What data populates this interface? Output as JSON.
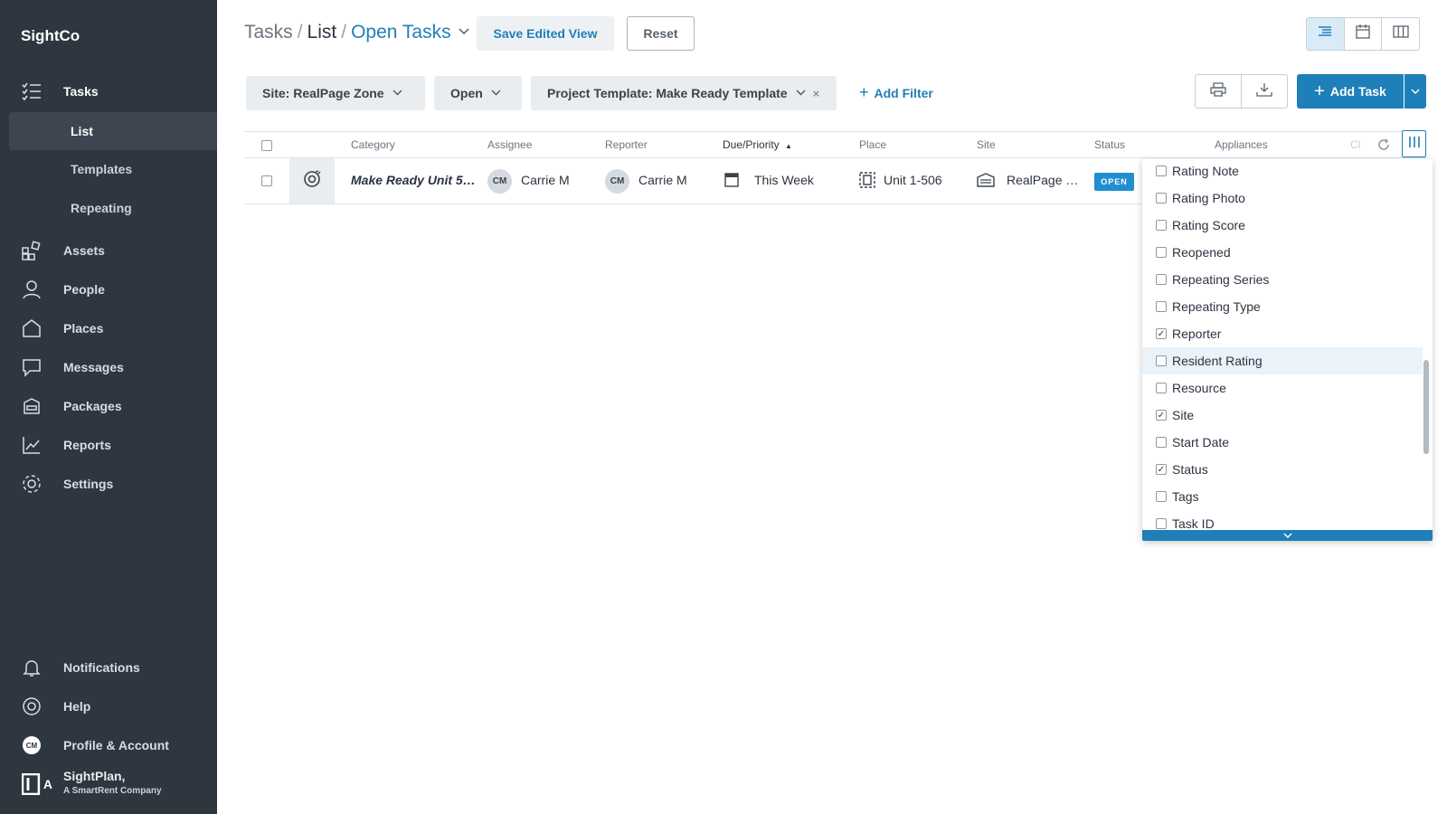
{
  "app": {
    "brand": "SightCo"
  },
  "sidebar": {
    "items": [
      {
        "label": "Tasks",
        "icon": "tasks-icon"
      },
      {
        "label": "Assets",
        "icon": "assets-icon"
      },
      {
        "label": "People",
        "icon": "person-icon"
      },
      {
        "label": "Places",
        "icon": "home-icon"
      },
      {
        "label": "Messages",
        "icon": "chat-icon"
      },
      {
        "label": "Packages",
        "icon": "package-icon"
      },
      {
        "label": "Reports",
        "icon": "chart-icon"
      },
      {
        "label": "Settings",
        "icon": "gear-icon"
      }
    ],
    "subitems": [
      {
        "label": "List",
        "active": true
      },
      {
        "label": "Templates"
      },
      {
        "label": "Repeating"
      }
    ],
    "bottom": {
      "notifications": "Notifications",
      "help": "Help",
      "profile": "Profile & Account",
      "profile_initials": "CM",
      "logo_line1": "SightPlan,",
      "logo_line2": "A SmartRent Company",
      "logo_letter": "A"
    }
  },
  "header": {
    "breadcrumb": {
      "root": "Tasks",
      "sep": "/",
      "current": "List",
      "view": "Open Tasks"
    },
    "save_view": "Save Edited View",
    "reset": "Reset"
  },
  "filters": {
    "site": "Site: RealPage Zone",
    "status": "Open",
    "template": "Project Template: Make Ready Template",
    "remove": "×",
    "add_filter": "Add Filter"
  },
  "actions": {
    "add_task": "Add Task"
  },
  "table": {
    "columns": [
      "Category",
      "Assignee",
      "Reporter",
      "Due/Priority",
      "Place",
      "Site",
      "Status",
      "Appliances",
      "Cl"
    ],
    "sort_indicator": "▲",
    "rows": [
      {
        "title": "Make Ready Unit 5…",
        "assignee_initials": "CM",
        "assignee": "Carrie M",
        "reporter_initials": "CM",
        "reporter": "Carrie M",
        "due": "This Week",
        "place": "Unit 1-506",
        "site": "RealPage …",
        "status": "OPEN"
      }
    ]
  },
  "column_picker": {
    "items": [
      {
        "label": "Rating Note",
        "checked": false
      },
      {
        "label": "Rating Photo",
        "checked": false
      },
      {
        "label": "Rating Score",
        "checked": false
      },
      {
        "label": "Reopened",
        "checked": false
      },
      {
        "label": "Repeating Series",
        "checked": false
      },
      {
        "label": "Repeating Type",
        "checked": false
      },
      {
        "label": "Reporter",
        "checked": true
      },
      {
        "label": "Resident Rating",
        "checked": false,
        "hover": true
      },
      {
        "label": "Resource",
        "checked": false
      },
      {
        "label": "Site",
        "checked": true
      },
      {
        "label": "Start Date",
        "checked": false
      },
      {
        "label": "Status",
        "checked": true
      },
      {
        "label": "Tags",
        "checked": false
      },
      {
        "label": "Task ID",
        "checked": false
      }
    ]
  },
  "colors": {
    "sidebar_bg": "#2e3740",
    "accent": "#1f7fb8",
    "status_open": "#1f8fd0"
  }
}
